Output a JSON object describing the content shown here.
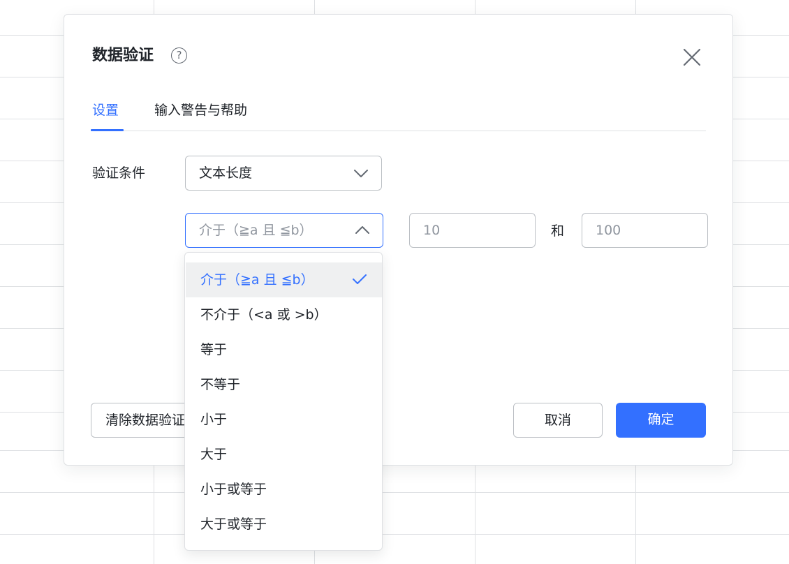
{
  "dialog": {
    "title": "数据验证",
    "help_icon": "question-circle-icon",
    "close_icon": "close-icon"
  },
  "tabs": [
    {
      "label": "设置",
      "active": true
    },
    {
      "label": "输入警告与帮助",
      "active": false
    }
  ],
  "condition": {
    "label": "验证条件",
    "type_value": "文本长度",
    "operator_value": "介于（≧a 且 ≦b）",
    "value_a": "10",
    "and_label": "和",
    "value_b": "100"
  },
  "operator_menu": {
    "selected_index": 0,
    "items": [
      "介于（≧a 且 ≦b）",
      "不介于（<a 或 >b）",
      "等于",
      "不等于",
      "小于",
      "大于",
      "小于或等于",
      "大于或等于"
    ]
  },
  "buttons": {
    "clear": "清除数据验证",
    "cancel": "取消",
    "ok": "确定"
  },
  "colors": {
    "accent": "#3370ff",
    "border": "#bbbfc4",
    "text": "#1f2329",
    "placeholder": "#8f959e",
    "selected_bg": "#eff0f1"
  }
}
